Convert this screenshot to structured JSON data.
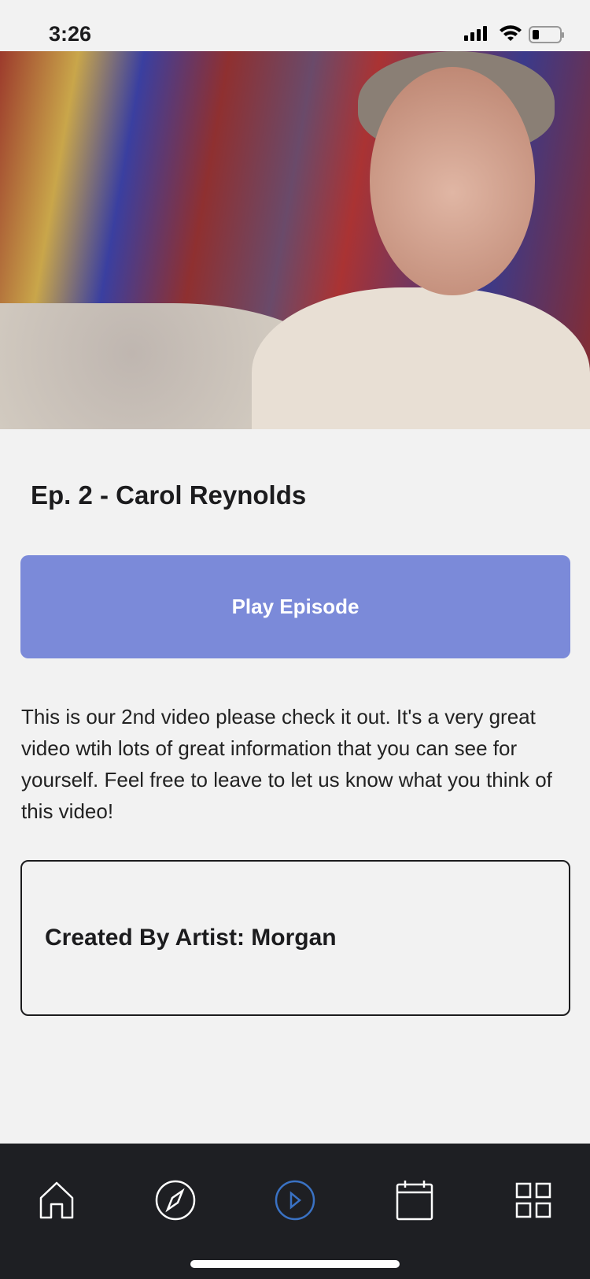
{
  "status": {
    "time": "3:26"
  },
  "episode": {
    "title": "Ep. 2 - Carol Reynolds",
    "play_label": "Play Episode",
    "description": "This is our 2nd video please check it out. It's a very great video wtih lots of great information that you can see for yourself. Feel free to leave to let us know what you think of this video!",
    "credit": "Created By Artist: Morgan"
  },
  "tabs": [
    "home-icon",
    "compass-icon",
    "play-circle-icon",
    "calendar-icon",
    "grid-icon"
  ],
  "colors": {
    "accent": "#7b8ad9",
    "active_tab": "#3a72c4",
    "tabbar": "#1e1f23"
  }
}
